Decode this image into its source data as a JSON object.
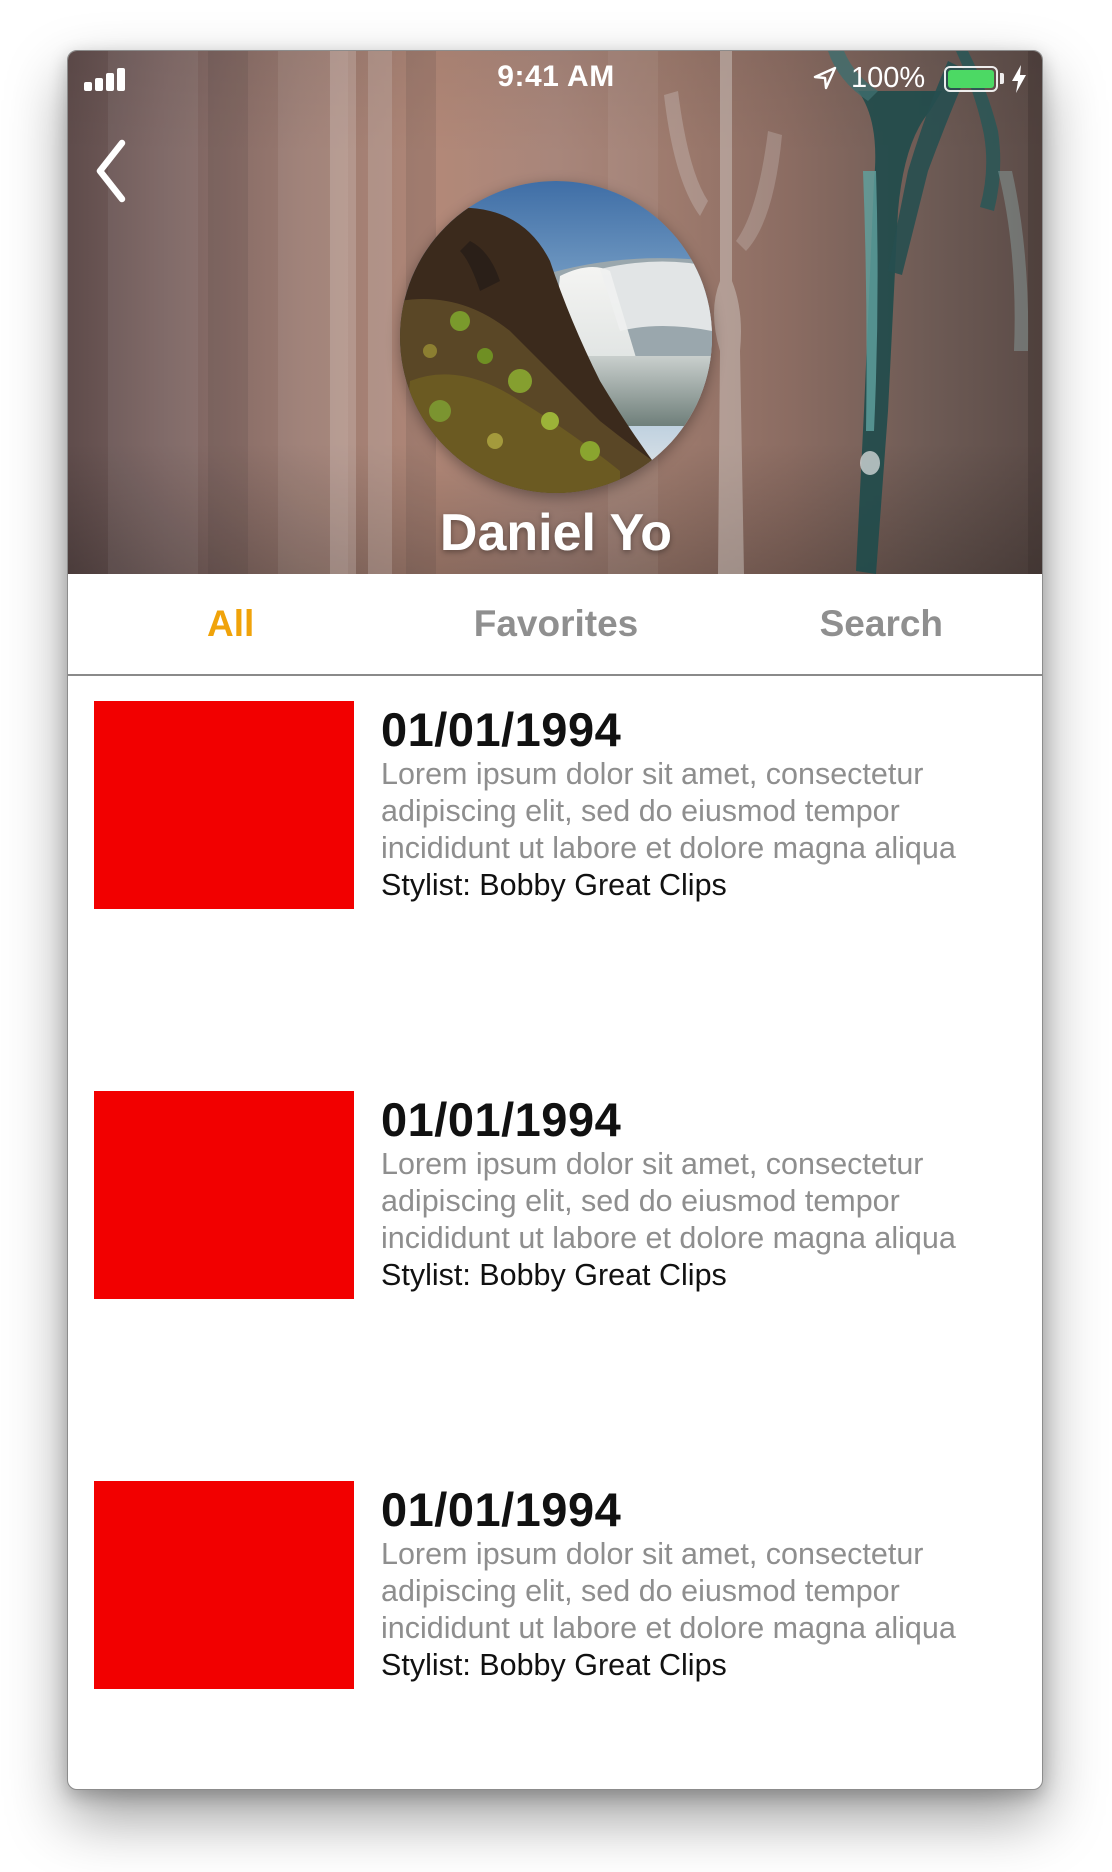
{
  "status_bar": {
    "time": "9:41 AM",
    "battery_percent": "100%",
    "battery_level": 1.0,
    "icons": [
      "signal-icon",
      "location-icon",
      "battery-icon",
      "charging-bolt-icon"
    ]
  },
  "header": {
    "back_icon": "chevron-left-icon",
    "avatar_description_icon": "profile-photo",
    "name": "Daniel Yo"
  },
  "tabs": [
    {
      "label": "All",
      "active": true
    },
    {
      "label": "Favorites",
      "active": false
    },
    {
      "label": "Search",
      "active": false
    }
  ],
  "colors": {
    "accent": "#f0a30a",
    "tab_inactive": "#8f8f8f",
    "thumbnail": "#f20000",
    "battery": "#4cd964"
  },
  "list": {
    "items": [
      {
        "date": "01/01/1994",
        "description": "Lorem ipsum dolor sit amet, consectetur adipiscing elit, sed do eiusmod tempor incididunt ut labore et dolore magna aliqua",
        "stylist": "Stylist: Bobby Great Clips"
      },
      {
        "date": "01/01/1994",
        "description": "Lorem ipsum dolor sit amet, consectetur adipiscing elit, sed do eiusmod tempor incididunt ut labore et dolore magna aliqua",
        "stylist": "Stylist: Bobby Great Clips"
      },
      {
        "date": "01/01/1994",
        "description": "Lorem ipsum dolor sit amet, consectetur adipiscing elit, sed do eiusmod tempor incididunt ut labore et dolore magna aliqua",
        "stylist": "Stylist: Bobby Great Clips"
      }
    ]
  }
}
